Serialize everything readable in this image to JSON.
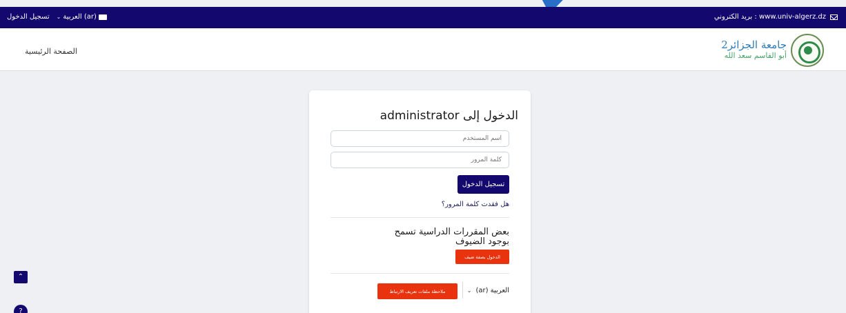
{
  "topbar": {
    "login_link": "تسجيل الدخول",
    "language": "العربية ‎(ar)‎",
    "email": "بريد الكتروني : www.univ-algerz.dz"
  },
  "header": {
    "home_link": "الصفحة الرئيسية",
    "logo_line1": "جامعة الجزائر2",
    "logo_line2": "أبو القاسم سعد الله"
  },
  "login": {
    "title": "الدخول إلى administrator",
    "username_placeholder": "اسم المستخدم",
    "password_placeholder": "كلمة المرور",
    "submit_label": "تسجيل الدخول",
    "forgot_password": "هل فقدت كلمة المرور؟",
    "guest_heading": "بعض المقررات الدراسية تسمح بوجود الضيوف",
    "guest_button": "الدخول بصفة ضيف",
    "language_select": "العربية ‎(ar)‎",
    "cookie_notice_button": "ملاحظة ملفات تعريف الارتباط"
  },
  "floating": {
    "help_label": "?"
  },
  "colors": {
    "primary": "#13086d",
    "accent": "#e8330e",
    "background": "#eef0f3"
  }
}
